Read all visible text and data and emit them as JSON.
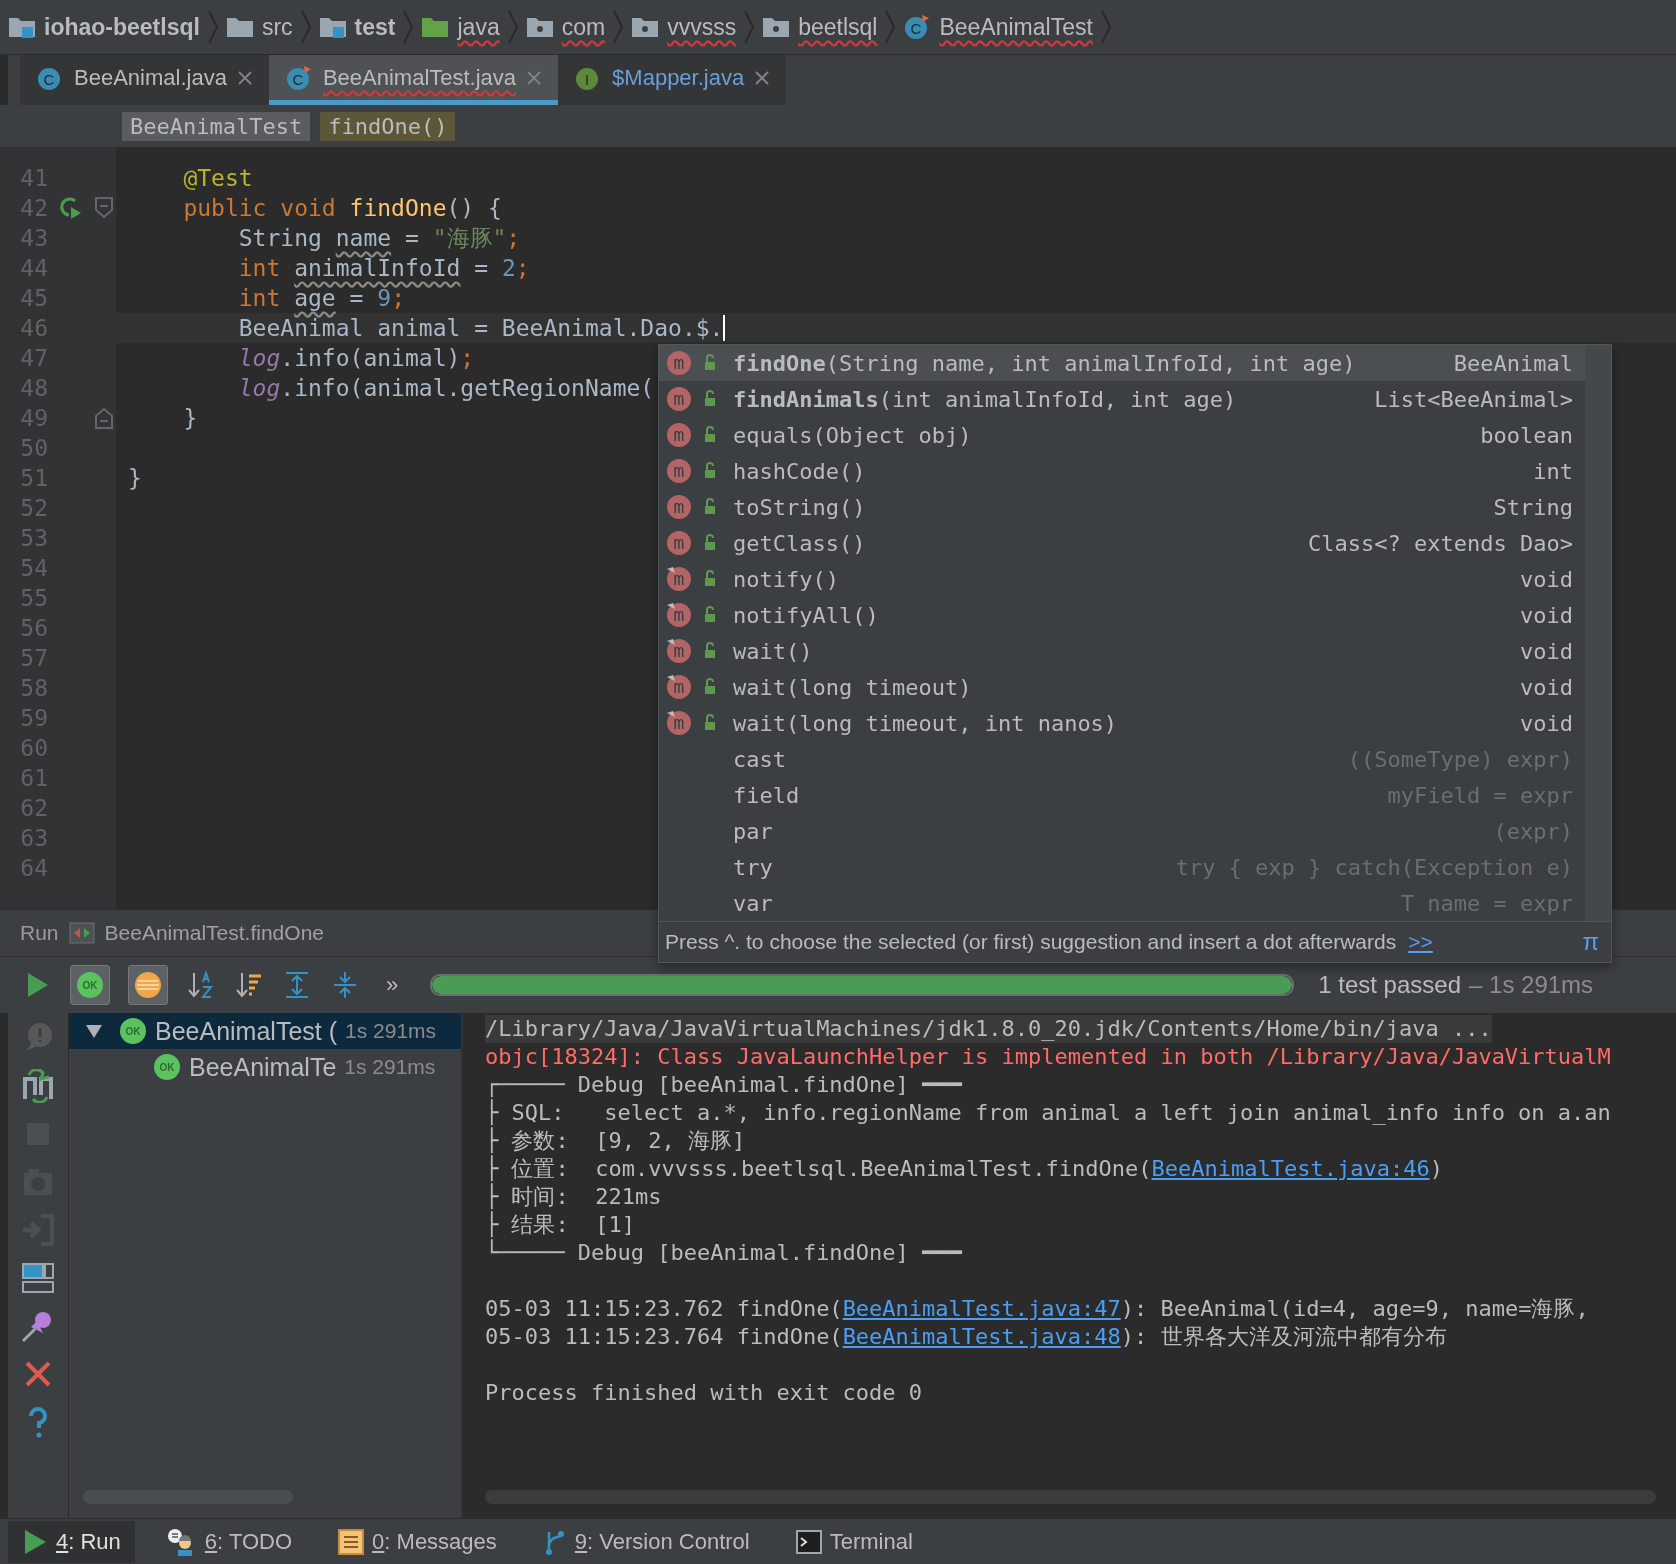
{
  "breadcrumbs": [
    {
      "label": "iohao-beetlsql",
      "kind": "module",
      "bold": true,
      "spell_warning": false
    },
    {
      "label": "src",
      "kind": "folder",
      "bold": false,
      "spell_warning": false
    },
    {
      "label": "test",
      "kind": "test-folder",
      "bold": true,
      "spell_warning": false
    },
    {
      "label": "java",
      "kind": "source-folder",
      "bold": false,
      "spell_warning": true
    },
    {
      "label": "com",
      "kind": "package",
      "bold": false,
      "spell_warning": true
    },
    {
      "label": "vvvsss",
      "kind": "package",
      "bold": false,
      "spell_warning": true
    },
    {
      "label": "beetlsql",
      "kind": "package",
      "bold": false,
      "spell_warning": true
    },
    {
      "label": "BeeAnimalTest",
      "kind": "class",
      "badge": "C",
      "bold": false,
      "spell_warning": true
    }
  ],
  "tabs": [
    {
      "label": "BeeAnimal.java",
      "kind": "class",
      "badge": "C",
      "selected": false,
      "spell_warning": false
    },
    {
      "label": "BeeAnimalTest.java",
      "kind": "test-class",
      "badge": "C",
      "selected": true,
      "spell_warning": true
    },
    {
      "label": "$Mapper.java",
      "kind": "interface",
      "badge": "I",
      "selected": false,
      "spell_warning": false
    }
  ],
  "code_breadcrumb": [
    {
      "label": "BeeAnimalTest",
      "selected": false
    },
    {
      "label": "findOne()",
      "selected": true
    }
  ],
  "editor": {
    "lines": [
      {
        "number": "41",
        "tokens": [
          {
            "text": "    @Test",
            "kind": "annotation"
          }
        ]
      },
      {
        "number": "42",
        "runnable": true,
        "fold_start": true,
        "tokens": [
          {
            "text": "    public void ",
            "kind": "keyword"
          },
          {
            "text": "findOne",
            "kind": "method"
          },
          {
            "text": "() {",
            "kind": "plain"
          }
        ]
      },
      {
        "number": "43",
        "tokens": [
          {
            "text": "        String ",
            "kind": "plain"
          },
          {
            "text": "name",
            "kind": "unused"
          },
          {
            "text": " = ",
            "kind": "plain"
          },
          {
            "text": "\"海豚\"",
            "kind": "string"
          },
          {
            "text": ";",
            "kind": "keyword"
          }
        ]
      },
      {
        "number": "44",
        "tokens": [
          {
            "text": "        int ",
            "kind": "keyword"
          },
          {
            "text": "animalInfoId",
            "kind": "unused"
          },
          {
            "text": " = ",
            "kind": "plain"
          },
          {
            "text": "2",
            "kind": "number"
          },
          {
            "text": ";",
            "kind": "keyword"
          }
        ]
      },
      {
        "number": "45",
        "tokens": [
          {
            "text": "        int ",
            "kind": "keyword"
          },
          {
            "text": "age",
            "kind": "unused"
          },
          {
            "text": " = ",
            "kind": "plain"
          },
          {
            "text": "9",
            "kind": "number"
          },
          {
            "text": ";",
            "kind": "keyword"
          }
        ]
      },
      {
        "number": "46",
        "current": true,
        "caret": true,
        "tokens": [
          {
            "text": "        BeeAnimal animal = BeeAnimal.Dao.$.",
            "kind": "plain"
          }
        ]
      },
      {
        "number": "47",
        "tokens": [
          {
            "text": "        log",
            "kind": "static"
          },
          {
            "text": ".info(animal)",
            "kind": "plain"
          },
          {
            "text": ";",
            "kind": "keyword"
          }
        ]
      },
      {
        "number": "48",
        "tokens": [
          {
            "text": "        log",
            "kind": "static"
          },
          {
            "text": ".info(animal.getRegionName(",
            "kind": "plain"
          }
        ]
      },
      {
        "number": "49",
        "fold_end": true,
        "tokens": [
          {
            "text": "    }",
            "kind": "plain"
          }
        ]
      },
      {
        "number": "50"
      },
      {
        "number": "51",
        "tokens": [
          {
            "text": "}",
            "kind": "plain"
          }
        ]
      },
      {
        "number": "52"
      },
      {
        "number": "53"
      },
      {
        "number": "54"
      },
      {
        "number": "55"
      },
      {
        "number": "56"
      },
      {
        "number": "57"
      },
      {
        "number": "58"
      },
      {
        "number": "59"
      },
      {
        "number": "60"
      },
      {
        "number": "61"
      },
      {
        "number": "62"
      },
      {
        "number": "63"
      },
      {
        "number": "64"
      }
    ]
  },
  "completion": {
    "items": [
      {
        "kind": "method",
        "badge": "m",
        "name": "findOne",
        "params": "(String name, int animalInfoId, int age)",
        "type": "BeeAnimal",
        "bold": true,
        "inherited": false,
        "selected": true
      },
      {
        "kind": "method",
        "badge": "m",
        "name": "findAnimals",
        "params": "(int animalInfoId, int age)",
        "type": "List<BeeAnimal>",
        "bold": true,
        "inherited": false,
        "selected": false
      },
      {
        "kind": "method",
        "badge": "m",
        "name": "equals",
        "params": "(Object obj)",
        "type": "boolean",
        "bold": false,
        "inherited": false,
        "selected": false
      },
      {
        "kind": "method",
        "badge": "m",
        "name": "hashCode",
        "params": "()",
        "type": "int",
        "bold": false,
        "inherited": false,
        "selected": false
      },
      {
        "kind": "method",
        "badge": "m",
        "name": "toString",
        "params": "()",
        "type": "String",
        "bold": false,
        "inherited": false,
        "selected": false
      },
      {
        "kind": "method",
        "badge": "m",
        "name": "getClass",
        "params": "()",
        "type": "Class<? extends Dao>",
        "bold": false,
        "inherited": false,
        "selected": false
      },
      {
        "kind": "method",
        "badge": "m",
        "name": "notify",
        "params": "()",
        "type": "void",
        "bold": false,
        "inherited": true,
        "selected": false
      },
      {
        "kind": "method",
        "badge": "m",
        "name": "notifyAll",
        "params": "()",
        "type": "void",
        "bold": false,
        "inherited": true,
        "selected": false
      },
      {
        "kind": "method",
        "badge": "m",
        "name": "wait",
        "params": "()",
        "type": "void",
        "bold": false,
        "inherited": true,
        "selected": false
      },
      {
        "kind": "method",
        "badge": "m",
        "name": "wait",
        "params": "(long timeout)",
        "type": "void",
        "bold": false,
        "inherited": true,
        "selected": false
      },
      {
        "kind": "method",
        "badge": "m",
        "name": "wait",
        "params": "(long timeout, int nanos)",
        "type": "void",
        "bold": false,
        "inherited": true,
        "selected": false
      },
      {
        "kind": "template",
        "name": "cast",
        "type": "((SomeType) expr)",
        "selected": false
      },
      {
        "kind": "template",
        "name": "field",
        "type": "myField = expr",
        "selected": false
      },
      {
        "kind": "template",
        "name": "par",
        "type": "(expr)",
        "selected": false
      },
      {
        "kind": "template",
        "name": "try",
        "type": "try { exp } catch(Exception e)",
        "selected": false
      },
      {
        "kind": "template",
        "name": "var",
        "type": "T name = expr",
        "selected": false
      }
    ],
    "hint": "Press ^. to choose the selected (or first) suggestion and insert a dot afterwards",
    "hint_link": ">>",
    "pi": "π"
  },
  "run": {
    "title": "Run",
    "config": "BeeAnimalTest.findOne",
    "toolbar": [
      {
        "kind": "rerun"
      },
      {
        "kind": "show-passed",
        "badge": "OK",
        "selected": true
      },
      {
        "kind": "show-ignored",
        "selected": true
      },
      {
        "kind": "sort-alpha"
      },
      {
        "kind": "sort-duration"
      },
      {
        "kind": "expand-all"
      },
      {
        "kind": "collapse-all"
      },
      {
        "kind": "more",
        "label": "»"
      }
    ],
    "progress": {
      "level": 1.0,
      "status": "1 test passed",
      "time": "– 1s 291ms"
    },
    "side_tools": [
      {
        "kind": "warning",
        "disabled": true
      },
      {
        "kind": "rerun-failed",
        "disabled": false
      },
      {
        "kind": "stop",
        "disabled": true
      },
      {
        "kind": "camera",
        "disabled": true
      },
      {
        "kind": "exit",
        "disabled": true
      },
      {
        "kind": "layout",
        "disabled": false
      },
      {
        "kind": "pin",
        "disabled": false
      },
      {
        "kind": "close",
        "disabled": false
      },
      {
        "kind": "help",
        "disabled": false
      }
    ],
    "tree": [
      {
        "label": "BeeAnimalTest (",
        "time": "1s 291ms",
        "badge": "OK",
        "expanded": true,
        "selected": true,
        "children": [
          {
            "label": "BeeAnimalTe",
            "time": "1s 291ms",
            "badge": "OK",
            "selected": false
          }
        ]
      }
    ],
    "console": [
      {
        "lines": [
          {
            "kind": "command",
            "segments": [
              {
                "text": "/Library/Java/JavaVirtualMachines/jdk1.8.0_20.jdk/Contents/Home/bin/java ...",
                "link": false
              }
            ]
          },
          {
            "kind": "error",
            "segments": [
              {
                "text": "objc[18324]: Class JavaLaunchHelper is implemented in both /Library/Java/JavaVirtualM",
                "link": false
              }
            ]
          },
          {
            "kind": "output",
            "segments": [
              {
                "text": "┌───── Debug [beeAnimal.findOne] ━━━",
                "link": false
              }
            ]
          },
          {
            "kind": "output",
            "segments": [
              {
                "text": "├ SQL:   select a.*, info.regionName from animal a left join animal_info info on a.an",
                "link": false
              }
            ]
          },
          {
            "kind": "output",
            "segments": [
              {
                "text": "├ 参数:  [9, 2, 海豚]",
                "link": false
              }
            ]
          },
          {
            "kind": "output",
            "segments": [
              {
                "text": "├ 位置:  com.vvvsss.beetlsql.BeeAnimalTest.findOne(",
                "link": false
              },
              {
                "text": "BeeAnimalTest.java:46",
                "link": true
              },
              {
                "text": ")",
                "link": false
              }
            ]
          },
          {
            "kind": "output",
            "segments": [
              {
                "text": "├ 时间:  221ms",
                "link": false
              }
            ]
          },
          {
            "kind": "output",
            "segments": [
              {
                "text": "├ 结果:  [1]",
                "link": false
              }
            ]
          },
          {
            "kind": "output",
            "segments": [
              {
                "text": "└───── Debug [beeAnimal.findOne] ━━━",
                "link": false
              }
            ]
          }
        ]
      },
      {
        "lines": [
          {
            "kind": "output",
            "segments": [
              {
                "text": "05-03 11:15:23.762 findOne(",
                "link": false
              },
              {
                "text": "BeeAnimalTest.java:47",
                "link": true
              },
              {
                "text": "): BeeAnimal(id=4, age=9, name=海豚,",
                "link": false
              }
            ]
          },
          {
            "kind": "output",
            "segments": [
              {
                "text": "05-03 11:15:23.764 findOne(",
                "link": false
              },
              {
                "text": "BeeAnimalTest.java:48",
                "link": true
              },
              {
                "text": "): 世界各大洋及河流中都有分布",
                "link": false
              }
            ]
          }
        ]
      },
      {
        "lines": [
          {
            "kind": "output",
            "segments": [
              {
                "text": "Process finished with exit code 0",
                "link": false
              }
            ]
          }
        ]
      }
    ]
  },
  "tool_windows": [
    {
      "mnemonic": "4",
      "label": ": Run",
      "kind": "run",
      "selected": true
    },
    {
      "mnemonic": "6",
      "label": ": TODO",
      "kind": "todo",
      "selected": false
    },
    {
      "mnemonic": "0",
      "label": ": Messages",
      "kind": "messages",
      "selected": false
    },
    {
      "mnemonic": "9",
      "label": ": Version Control",
      "kind": "vcs",
      "selected": false
    },
    {
      "label": "Terminal",
      "kind": "terminal",
      "selected": false
    }
  ]
}
